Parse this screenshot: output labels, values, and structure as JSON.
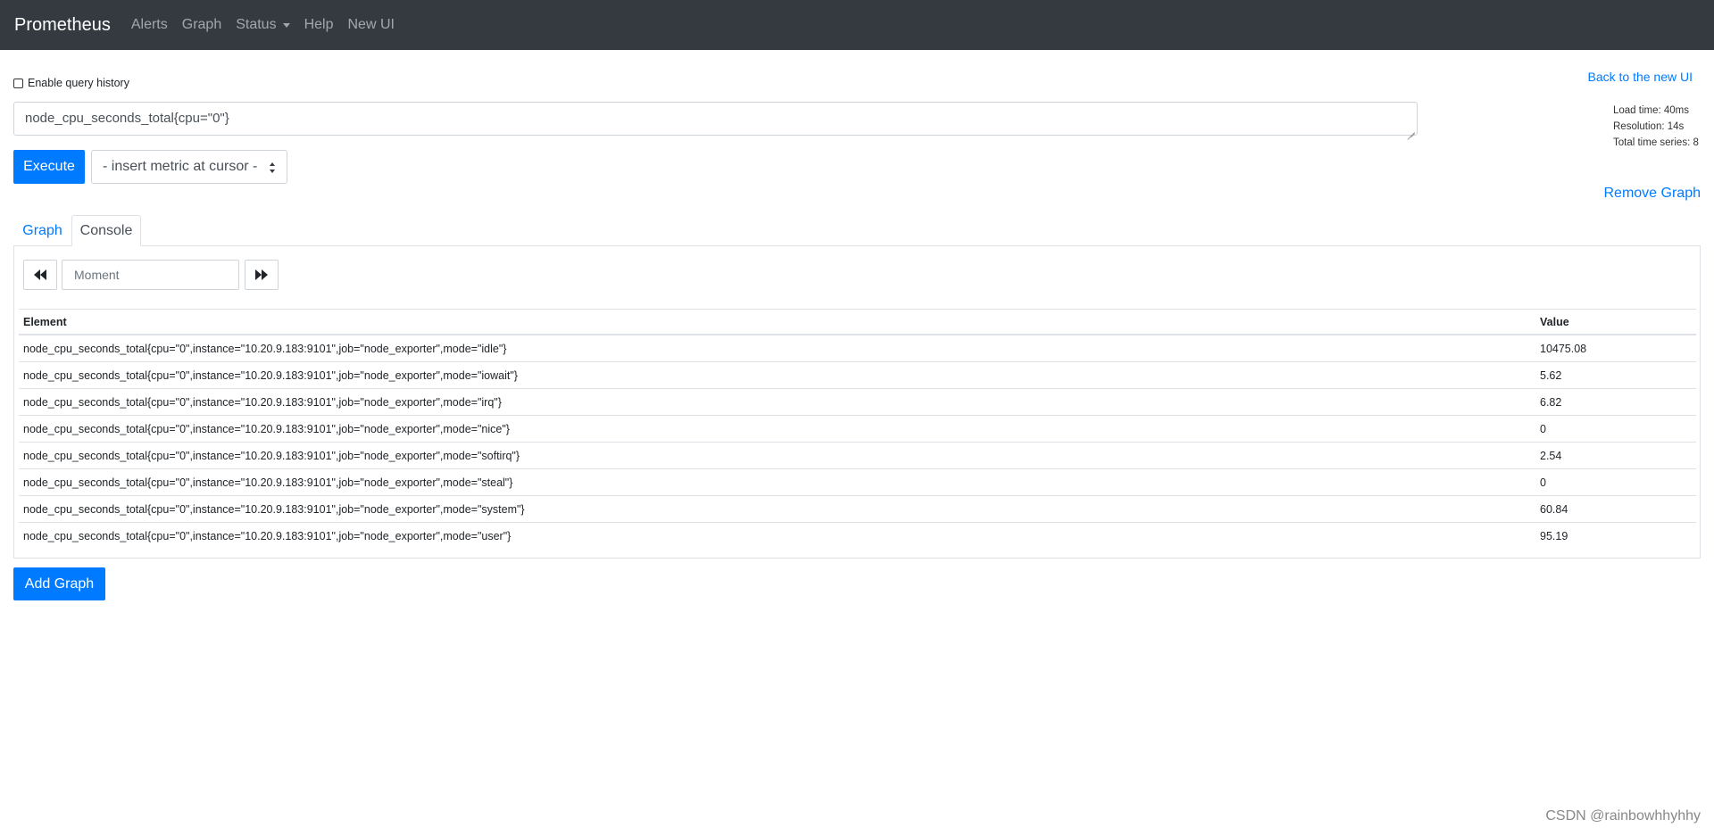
{
  "navbar": {
    "brand": "Prometheus",
    "items": [
      {
        "label": "Alerts"
      },
      {
        "label": "Graph"
      },
      {
        "label": "Status"
      },
      {
        "label": "Help"
      },
      {
        "label": "New UI"
      }
    ]
  },
  "query_history": {
    "label": "Enable query history",
    "checked": false
  },
  "back_link": "Back to the new UI",
  "query": {
    "value": "node_cpu_seconds_total{cpu=\"0\"}"
  },
  "stats": {
    "load_time": "Load time: 40ms",
    "resolution": "Resolution: 14s",
    "total_series": "Total time series: 8"
  },
  "execute_label": "Execute",
  "metric_select": {
    "selected": "- insert metric at cursor -"
  },
  "remove_graph": "Remove Graph",
  "tabs": [
    {
      "label": "Graph",
      "active": false
    },
    {
      "label": "Console",
      "active": true
    }
  ],
  "moment": {
    "placeholder": "Moment"
  },
  "table": {
    "headers": [
      "Element",
      "Value"
    ],
    "rows": [
      {
        "element": "node_cpu_seconds_total{cpu=\"0\",instance=\"10.20.9.183:9101\",job=\"node_exporter\",mode=\"idle\"}",
        "value": "10475.08"
      },
      {
        "element": "node_cpu_seconds_total{cpu=\"0\",instance=\"10.20.9.183:9101\",job=\"node_exporter\",mode=\"iowait\"}",
        "value": "5.62"
      },
      {
        "element": "node_cpu_seconds_total{cpu=\"0\",instance=\"10.20.9.183:9101\",job=\"node_exporter\",mode=\"irq\"}",
        "value": "6.82"
      },
      {
        "element": "node_cpu_seconds_total{cpu=\"0\",instance=\"10.20.9.183:9101\",job=\"node_exporter\",mode=\"nice\"}",
        "value": "0"
      },
      {
        "element": "node_cpu_seconds_total{cpu=\"0\",instance=\"10.20.9.183:9101\",job=\"node_exporter\",mode=\"softirq\"}",
        "value": "2.54"
      },
      {
        "element": "node_cpu_seconds_total{cpu=\"0\",instance=\"10.20.9.183:9101\",job=\"node_exporter\",mode=\"steal\"}",
        "value": "0"
      },
      {
        "element": "node_cpu_seconds_total{cpu=\"0\",instance=\"10.20.9.183:9101\",job=\"node_exporter\",mode=\"system\"}",
        "value": "60.84"
      },
      {
        "element": "node_cpu_seconds_total{cpu=\"0\",instance=\"10.20.9.183:9101\",job=\"node_exporter\",mode=\"user\"}",
        "value": "95.19"
      }
    ]
  },
  "add_graph": "Add Graph",
  "watermark": "CSDN @rainbowhhyhhy",
  "colors": {
    "navbar_bg": "#343a40",
    "primary": "#007bff",
    "border": "#dee2e6"
  },
  "icons": {
    "prev": "fast-backward-icon",
    "next": "fast-forward-icon"
  }
}
